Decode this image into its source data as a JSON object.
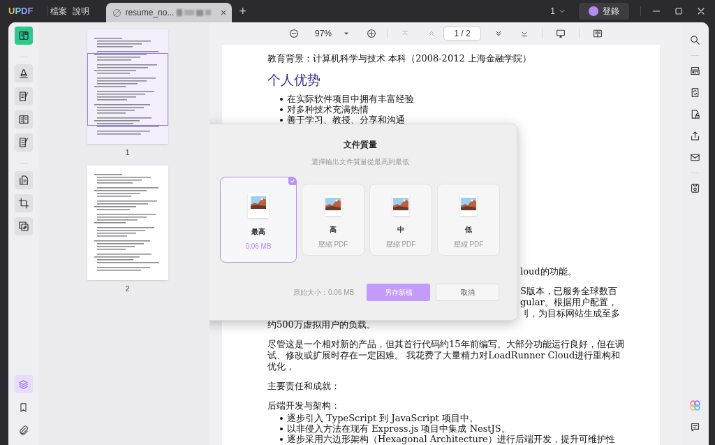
{
  "title_bar": {
    "logo": "UPDF",
    "menus": [
      "檔案",
      "說明"
    ],
    "tab": {
      "title": "resume_no...",
      "close": "×"
    },
    "new_tab": "+",
    "page_count": "1",
    "login": "登錄"
  },
  "left_tools": [
    {
      "selected": true
    },
    {
      "selected": false
    },
    {
      "selected": false
    },
    {
      "selected": false
    },
    {
      "selected": false
    },
    {
      "selected": false
    },
    {
      "selected": false
    },
    {
      "selected": false
    }
  ],
  "left_bottom": [
    {
      "selected": true
    },
    {
      "selected": false
    },
    {
      "selected": false
    }
  ],
  "thumbnails": [
    {
      "label": "1",
      "selected": true
    },
    {
      "label": "2",
      "selected": false
    }
  ],
  "toolbar": {
    "zoom": "97%",
    "page": "1 / 2"
  },
  "document": {
    "blocks": [
      {
        "kind": "text",
        "text": "教育背景：计算机科学与技术 本科（2008-2012 上海金融学院）"
      },
      {
        "kind": "heading",
        "text": "个人优势"
      },
      {
        "kind": "bullets",
        "items": [
          "在实际软件项目中拥有丰富经验",
          "对多种技术充满热情",
          "善于学习、教授、分享和沟通"
        ]
      },
      {
        "kind": "partial",
        "text": "loud的功能。"
      },
      {
        "kind": "partial",
        "text": "S版本，已服务全球数百"
      },
      {
        "kind": "partial",
        "text": "gular。根据用户配置，"
      },
      {
        "kind": "partial",
        "text": "刂，为目标网站生成至多"
      },
      {
        "kind": "text",
        "text": "约500万虚拟用户的负载。"
      },
      {
        "kind": "text",
        "text": "尽管这是一个相对新的产品，但其首行代码约15年前编写。大部分功能运行良好，但在调试、修改或扩展时存在一定困难。 我花费了大量精力对LoadRunner Cloud进行重构和优化，"
      },
      {
        "kind": "text",
        "text": "主要责任和成就："
      },
      {
        "kind": "text",
        "text": "后端开发与架构："
      },
      {
        "kind": "bullets",
        "items": [
          "逐步引入 TypeScript 到 JavaScript 项目中。",
          "以非侵入方法在现有 Express.js 项目中集成 NestJS。",
          "逐步采用六边形架构（Hexagonal Architecture）进行后端开发，提升可维护性"
        ]
      }
    ]
  },
  "dialog": {
    "title": "文件質量",
    "subtitle": "選擇輸出文件質量從最高到最低",
    "options": [
      {
        "label": "最高",
        "detail": "0.06 MB",
        "selected": true
      },
      {
        "label": "高",
        "detail": "壓縮 PDF",
        "selected": false
      },
      {
        "label": "中",
        "detail": "壓縮 PDF",
        "selected": false
      },
      {
        "label": "低",
        "detail": "壓縮 PDF",
        "selected": false
      }
    ],
    "original_size": "原始大小：0.06 MB",
    "save_button": "另存新檔",
    "cancel_button": "取消"
  }
}
